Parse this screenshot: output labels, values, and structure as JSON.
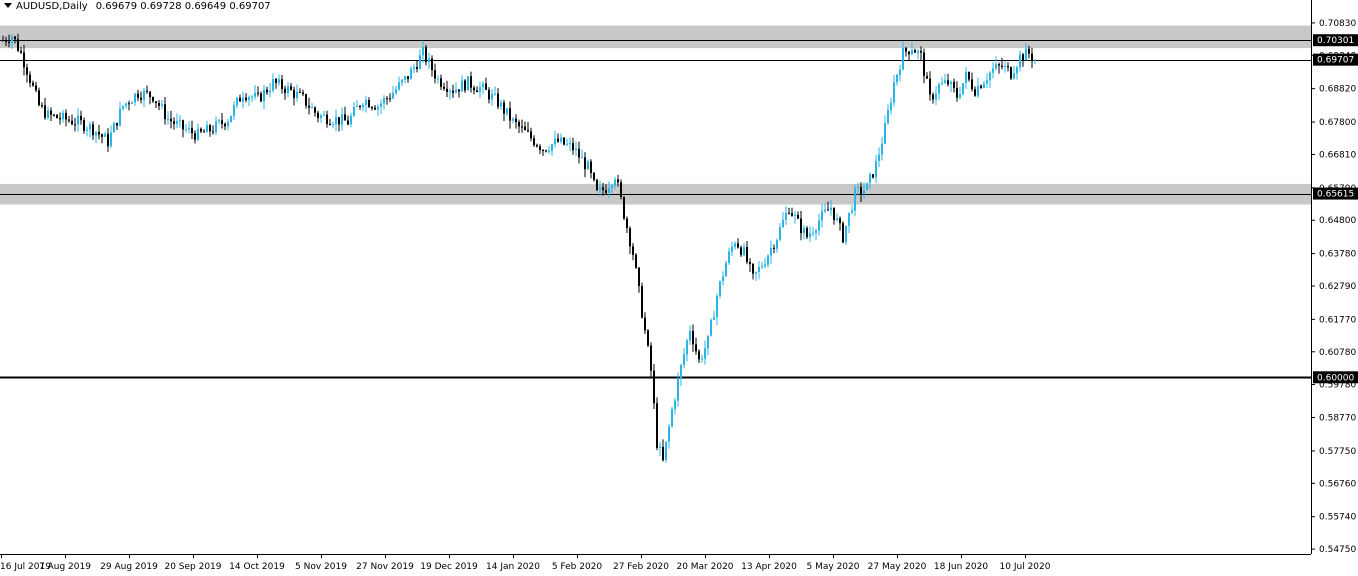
{
  "header": {
    "symbol": "AUDUSD,Daily",
    "ohlc": "0.69679 0.69728 0.69649 0.69707"
  },
  "colors": {
    "bull": "#29b6e6",
    "bear": "#000000",
    "zone": "#c8c8c8",
    "axis": "#000000",
    "background": "#ffffff"
  },
  "chart_data": {
    "type": "candlestick",
    "title": "AUDUSD,Daily",
    "y_ticks": [
      "0.70830",
      "0.69840",
      "0.68820",
      "0.67800",
      "0.66810",
      "0.65790",
      "0.64800",
      "0.63780",
      "0.62790",
      "0.61770",
      "0.60780",
      "0.59780",
      "0.58770",
      "0.57750",
      "0.56760",
      "0.55740",
      "0.54750"
    ],
    "x_ticks": [
      "16 Jul 2019",
      "7 Aug 2019",
      "29 Aug 2019",
      "20 Sep 2019",
      "14 Oct 2019",
      "5 Nov 2019",
      "27 Nov 2019",
      "19 Dec 2019",
      "14 Jan 2020",
      "5 Feb 2020",
      "27 Feb 2020",
      "20 Mar 2020",
      "13 Apr 2020",
      "5 May 2020",
      "27 May 2020",
      "18 Jun 2020",
      "10 Jul 2020"
    ],
    "ylim": [
      0.546,
      0.7098
    ],
    "price_flags": [
      {
        "label": "0.70301",
        "value": 0.70301
      },
      {
        "label": "0.69707",
        "value": 0.69707
      },
      {
        "label": "0.65615",
        "value": 0.65615
      },
      {
        "label": "0.60000",
        "value": 0.6
      }
    ],
    "horizontal_lines": [
      0.70301,
      0.69707,
      0.65615,
      0.6
    ],
    "zones": [
      {
        "from": 0.7006,
        "to": 0.7075
      },
      {
        "from": 0.6528,
        "to": 0.6591
      }
    ],
    "close_path": [
      [
        0,
        0.703
      ],
      [
        3,
        0.7045
      ],
      [
        6,
        0.699
      ],
      [
        8,
        0.694
      ],
      [
        12,
        0.683
      ],
      [
        15,
        0.68
      ],
      [
        20,
        0.679
      ],
      [
        25,
        0.678
      ],
      [
        30,
        0.676
      ],
      [
        35,
        0.672
      ],
      [
        40,
        0.683
      ],
      [
        45,
        0.687
      ],
      [
        50,
        0.686
      ],
      [
        55,
        0.679
      ],
      [
        60,
        0.676
      ],
      [
        65,
        0.674
      ],
      [
        70,
        0.676
      ],
      [
        75,
        0.679
      ],
      [
        80,
        0.687
      ],
      [
        85,
        0.685
      ],
      [
        90,
        0.69
      ],
      [
        95,
        0.688
      ],
      [
        100,
        0.685
      ],
      [
        105,
        0.68
      ],
      [
        110,
        0.679
      ],
      [
        115,
        0.678
      ],
      [
        120,
        0.685
      ],
      [
        125,
        0.683
      ],
      [
        130,
        0.687
      ],
      [
        135,
        0.692
      ],
      [
        140,
        0.699
      ],
      [
        145,
        0.691
      ],
      [
        150,
        0.688
      ],
      [
        155,
        0.69
      ],
      [
        160,
        0.688
      ],
      [
        165,
        0.684
      ],
      [
        170,
        0.678
      ],
      [
        175,
        0.674
      ],
      [
        180,
        0.67
      ],
      [
        185,
        0.672
      ],
      [
        190,
        0.67
      ],
      [
        195,
        0.664
      ],
      [
        198,
        0.656
      ],
      [
        201,
        0.658
      ],
      [
        204,
        0.662
      ],
      [
        207,
        0.65
      ],
      [
        210,
        0.638
      ],
      [
        213,
        0.62
      ],
      [
        216,
        0.602
      ],
      [
        218,
        0.58
      ],
      [
        220,
        0.574
      ],
      [
        223,
        0.59
      ],
      [
        226,
        0.603
      ],
      [
        229,
        0.615
      ],
      [
        232,
        0.605
      ],
      [
        235,
        0.611
      ],
      [
        238,
        0.625
      ],
      [
        241,
        0.635
      ],
      [
        244,
        0.642
      ],
      [
        247,
        0.638
      ],
      [
        250,
        0.63
      ],
      [
        254,
        0.636
      ],
      [
        258,
        0.643
      ],
      [
        262,
        0.652
      ],
      [
        265,
        0.647
      ],
      [
        268,
        0.643
      ],
      [
        272,
        0.648
      ],
      [
        276,
        0.652
      ],
      [
        280,
        0.643
      ],
      [
        284,
        0.656
      ],
      [
        288,
        0.658
      ],
      [
        291,
        0.665
      ],
      [
        294,
        0.676
      ],
      [
        297,
        0.69
      ],
      [
        300,
        0.699
      ],
      [
        303,
        0.701
      ],
      [
        306,
        0.698
      ],
      [
        309,
        0.685
      ],
      [
        312,
        0.689
      ],
      [
        315,
        0.69
      ],
      [
        318,
        0.686
      ],
      [
        321,
        0.692
      ],
      [
        324,
        0.688
      ],
      [
        327,
        0.691
      ],
      [
        330,
        0.694
      ],
      [
        333,
        0.695
      ],
      [
        336,
        0.693
      ],
      [
        339,
        0.698
      ],
      [
        342,
        0.699
      ],
      [
        344,
        0.6971
      ]
    ]
  }
}
